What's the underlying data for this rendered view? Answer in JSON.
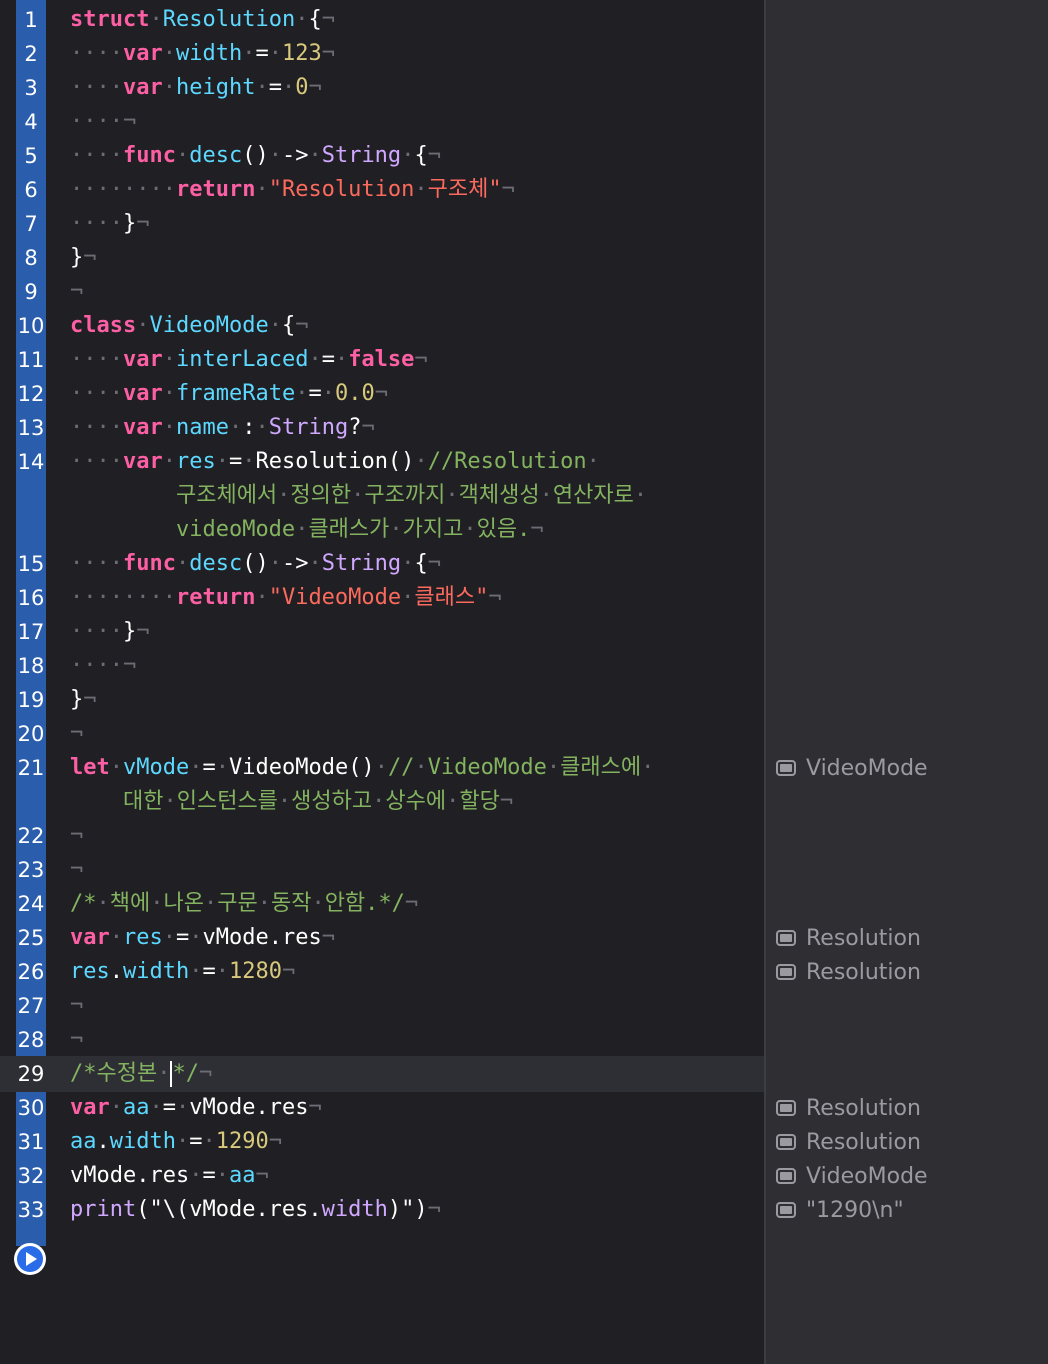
{
  "editor": {
    "highlighted_line": 29,
    "lines": [
      {
        "n": "1",
        "rows": [
          [
            [
              "kw",
              "struct"
            ],
            [
              "ws",
              "·"
            ],
            [
              "decl",
              "Resolution"
            ],
            [
              "ws",
              "·"
            ],
            [
              "pl",
              "{"
            ],
            [
              "ws",
              "¬"
            ]
          ]
        ]
      },
      {
        "n": "2",
        "rows": [
          [
            [
              "ws",
              "····"
            ],
            [
              "kw",
              "var"
            ],
            [
              "ws",
              "·"
            ],
            [
              "decl",
              "width"
            ],
            [
              "ws",
              "·"
            ],
            [
              "pl",
              "="
            ],
            [
              "ws",
              "·"
            ],
            [
              "num",
              "123"
            ],
            [
              "ws",
              "¬"
            ]
          ]
        ]
      },
      {
        "n": "3",
        "rows": [
          [
            [
              "ws",
              "····"
            ],
            [
              "kw",
              "var"
            ],
            [
              "ws",
              "·"
            ],
            [
              "decl",
              "height"
            ],
            [
              "ws",
              "·"
            ],
            [
              "pl",
              "="
            ],
            [
              "ws",
              "·"
            ],
            [
              "num",
              "0"
            ],
            [
              "ws",
              "¬"
            ]
          ]
        ]
      },
      {
        "n": "4",
        "rows": [
          [
            [
              "ws",
              "····¬"
            ]
          ]
        ]
      },
      {
        "n": "5",
        "rows": [
          [
            [
              "ws",
              "····"
            ],
            [
              "kw",
              "func"
            ],
            [
              "ws",
              "·"
            ],
            [
              "decl",
              "desc"
            ],
            [
              "pl",
              "()"
            ],
            [
              "ws",
              "·"
            ],
            [
              "pl",
              "->"
            ],
            [
              "ws",
              "·"
            ],
            [
              "ty",
              "String"
            ],
            [
              "ws",
              "·"
            ],
            [
              "pl",
              "{"
            ],
            [
              "ws",
              "¬"
            ]
          ]
        ]
      },
      {
        "n": "6",
        "rows": [
          [
            [
              "ws",
              "········"
            ],
            [
              "kw",
              "return"
            ],
            [
              "ws",
              "·"
            ],
            [
              "str",
              "\"Resolution"
            ],
            [
              "ws",
              "·"
            ],
            [
              "str",
              "구조체\""
            ],
            [
              "ws",
              "¬"
            ]
          ]
        ]
      },
      {
        "n": "7",
        "rows": [
          [
            [
              "ws",
              "····"
            ],
            [
              "pl",
              "}"
            ],
            [
              "ws",
              "¬"
            ]
          ]
        ]
      },
      {
        "n": "8",
        "rows": [
          [
            [
              "pl",
              "}"
            ],
            [
              "ws",
              "¬"
            ]
          ]
        ]
      },
      {
        "n": "9",
        "rows": [
          [
            [
              "ws",
              "¬"
            ]
          ]
        ]
      },
      {
        "n": "10",
        "rows": [
          [
            [
              "kw",
              "class"
            ],
            [
              "ws",
              "·"
            ],
            [
              "decl",
              "VideoMode"
            ],
            [
              "ws",
              "·"
            ],
            [
              "pl",
              "{"
            ],
            [
              "ws",
              "¬"
            ]
          ]
        ]
      },
      {
        "n": "11",
        "rows": [
          [
            [
              "ws",
              "····"
            ],
            [
              "kw",
              "var"
            ],
            [
              "ws",
              "·"
            ],
            [
              "decl",
              "interLaced"
            ],
            [
              "ws",
              "·"
            ],
            [
              "pl",
              "="
            ],
            [
              "ws",
              "·"
            ],
            [
              "kw",
              "false"
            ],
            [
              "ws",
              "¬"
            ]
          ]
        ]
      },
      {
        "n": "12",
        "rows": [
          [
            [
              "ws",
              "····"
            ],
            [
              "kw",
              "var"
            ],
            [
              "ws",
              "·"
            ],
            [
              "decl",
              "frameRate"
            ],
            [
              "ws",
              "·"
            ],
            [
              "pl",
              "="
            ],
            [
              "ws",
              "·"
            ],
            [
              "num",
              "0.0"
            ],
            [
              "ws",
              "¬"
            ]
          ]
        ]
      },
      {
        "n": "13",
        "rows": [
          [
            [
              "ws",
              "····"
            ],
            [
              "kw",
              "var"
            ],
            [
              "ws",
              "·"
            ],
            [
              "decl",
              "name"
            ],
            [
              "ws",
              "·"
            ],
            [
              "pl",
              ":"
            ],
            [
              "ws",
              "·"
            ],
            [
              "ty",
              "String"
            ],
            [
              "pl",
              "?"
            ],
            [
              "ws",
              "¬"
            ]
          ]
        ]
      },
      {
        "n": "14",
        "rows": [
          [
            [
              "ws",
              "····"
            ],
            [
              "kw",
              "var"
            ],
            [
              "ws",
              "·"
            ],
            [
              "decl",
              "res"
            ],
            [
              "ws",
              "·"
            ],
            [
              "pl",
              "="
            ],
            [
              "ws",
              "·"
            ],
            [
              "pl",
              "Resolution()"
            ],
            [
              "ws",
              "·"
            ],
            [
              "cm",
              "//Resolution"
            ],
            [
              "ws",
              "·"
            ]
          ],
          [
            [
              "ws",
              "        "
            ],
            [
              "cm",
              "구조체에서"
            ],
            [
              "ws",
              "·"
            ],
            [
              "cm",
              "정의한"
            ],
            [
              "ws",
              "·"
            ],
            [
              "cm",
              "구조까지"
            ],
            [
              "ws",
              "·"
            ],
            [
              "cm",
              "객체생성"
            ],
            [
              "ws",
              "·"
            ],
            [
              "cm",
              "연산자로"
            ],
            [
              "ws",
              "·"
            ]
          ],
          [
            [
              "ws",
              "        "
            ],
            [
              "cm",
              "videoMode"
            ],
            [
              "ws",
              "·"
            ],
            [
              "cm",
              "클래스가"
            ],
            [
              "ws",
              "·"
            ],
            [
              "cm",
              "가지고"
            ],
            [
              "ws",
              "·"
            ],
            [
              "cm",
              "있음."
            ],
            [
              "ws",
              "¬"
            ]
          ]
        ]
      },
      {
        "n": "15",
        "rows": [
          [
            [
              "ws",
              "····"
            ],
            [
              "kw",
              "func"
            ],
            [
              "ws",
              "·"
            ],
            [
              "decl",
              "desc"
            ],
            [
              "pl",
              "()"
            ],
            [
              "ws",
              "·"
            ],
            [
              "pl",
              "->"
            ],
            [
              "ws",
              "·"
            ],
            [
              "ty",
              "String"
            ],
            [
              "ws",
              "·"
            ],
            [
              "pl",
              "{"
            ],
            [
              "ws",
              "¬"
            ]
          ]
        ]
      },
      {
        "n": "16",
        "rows": [
          [
            [
              "ws",
              "········"
            ],
            [
              "kw",
              "return"
            ],
            [
              "ws",
              "·"
            ],
            [
              "str",
              "\"VideoMode"
            ],
            [
              "ws",
              "·"
            ],
            [
              "str",
              "클래스\""
            ],
            [
              "ws",
              "¬"
            ]
          ]
        ]
      },
      {
        "n": "17",
        "rows": [
          [
            [
              "ws",
              "····"
            ],
            [
              "pl",
              "}"
            ],
            [
              "ws",
              "¬"
            ]
          ]
        ]
      },
      {
        "n": "18",
        "rows": [
          [
            [
              "ws",
              "····¬"
            ]
          ]
        ]
      },
      {
        "n": "19",
        "rows": [
          [
            [
              "pl",
              "}"
            ],
            [
              "ws",
              "¬"
            ]
          ]
        ]
      },
      {
        "n": "20",
        "rows": [
          [
            [
              "ws",
              "¬"
            ]
          ]
        ]
      },
      {
        "n": "21",
        "rows": [
          [
            [
              "kw",
              "let"
            ],
            [
              "ws",
              "·"
            ],
            [
              "decl",
              "vMode"
            ],
            [
              "ws",
              "·"
            ],
            [
              "pl",
              "="
            ],
            [
              "ws",
              "·"
            ],
            [
              "pl",
              "VideoMode()"
            ],
            [
              "ws",
              "·"
            ],
            [
              "cm",
              "//"
            ],
            [
              "ws",
              "·"
            ],
            [
              "cm",
              "VideoMode"
            ],
            [
              "ws",
              "·"
            ],
            [
              "cm",
              "클래스에"
            ],
            [
              "ws",
              "·"
            ]
          ],
          [
            [
              "ws",
              "    "
            ],
            [
              "cm",
              "대한"
            ],
            [
              "ws",
              "·"
            ],
            [
              "cm",
              "인스턴스를"
            ],
            [
              "ws",
              "·"
            ],
            [
              "cm",
              "생성하고"
            ],
            [
              "ws",
              "·"
            ],
            [
              "cm",
              "상수에"
            ],
            [
              "ws",
              "·"
            ],
            [
              "cm",
              "할당"
            ],
            [
              "ws",
              "¬"
            ]
          ]
        ]
      },
      {
        "n": "22",
        "rows": [
          [
            [
              "ws",
              "¬"
            ]
          ]
        ]
      },
      {
        "n": "23",
        "rows": [
          [
            [
              "ws",
              "¬"
            ]
          ]
        ]
      },
      {
        "n": "24",
        "rows": [
          [
            [
              "cm",
              "/*"
            ],
            [
              "ws",
              "·"
            ],
            [
              "cm",
              "책에"
            ],
            [
              "ws",
              "·"
            ],
            [
              "cm",
              "나온"
            ],
            [
              "ws",
              "·"
            ],
            [
              "cm",
              "구문"
            ],
            [
              "ws",
              "·"
            ],
            [
              "cm",
              "동작"
            ],
            [
              "ws",
              "·"
            ],
            [
              "cm",
              "안함.*/"
            ],
            [
              "ws",
              "¬"
            ]
          ]
        ]
      },
      {
        "n": "25",
        "rows": [
          [
            [
              "kw",
              "var"
            ],
            [
              "ws",
              "·"
            ],
            [
              "decl",
              "res"
            ],
            [
              "ws",
              "·"
            ],
            [
              "pl",
              "="
            ],
            [
              "ws",
              "·"
            ],
            [
              "pl",
              "vMode.res"
            ],
            [
              "ws",
              "¬"
            ]
          ]
        ]
      },
      {
        "n": "26",
        "rows": [
          [
            [
              "decl",
              "res"
            ],
            [
              "pl",
              "."
            ],
            [
              "decl",
              "width"
            ],
            [
              "ws",
              "·"
            ],
            [
              "pl",
              "="
            ],
            [
              "ws",
              "·"
            ],
            [
              "num",
              "1280"
            ],
            [
              "ws",
              "¬"
            ]
          ]
        ]
      },
      {
        "n": "27",
        "rows": [
          [
            [
              "ws",
              "¬"
            ]
          ]
        ]
      },
      {
        "n": "28",
        "rows": [
          [
            [
              "ws",
              "¬"
            ]
          ]
        ]
      },
      {
        "n": "29",
        "rows": [
          [
            [
              "cm",
              "/*수정본"
            ],
            [
              "ws",
              "·"
            ],
            [
              "cursor",
              ""
            ],
            [
              "cm",
              "*/"
            ],
            [
              "ws",
              "¬"
            ]
          ]
        ]
      },
      {
        "n": "30",
        "rows": [
          [
            [
              "kw",
              "var"
            ],
            [
              "ws",
              "·"
            ],
            [
              "decl",
              "aa"
            ],
            [
              "ws",
              "·"
            ],
            [
              "pl",
              "="
            ],
            [
              "ws",
              "·"
            ],
            [
              "pl",
              "vMode.res"
            ],
            [
              "ws",
              "¬"
            ]
          ]
        ]
      },
      {
        "n": "31",
        "rows": [
          [
            [
              "decl",
              "aa"
            ],
            [
              "pl",
              "."
            ],
            [
              "decl",
              "width"
            ],
            [
              "ws",
              "·"
            ],
            [
              "pl",
              "="
            ],
            [
              "ws",
              "·"
            ],
            [
              "num",
              "1290"
            ],
            [
              "ws",
              "¬"
            ]
          ]
        ]
      },
      {
        "n": "32",
        "rows": [
          [
            [
              "pl",
              "vMode.res"
            ],
            [
              "ws",
              "·"
            ],
            [
              "pl",
              "="
            ],
            [
              "ws",
              "·"
            ],
            [
              "decl",
              "aa"
            ],
            [
              "ws",
              "¬"
            ]
          ]
        ]
      },
      {
        "n": "33",
        "rows": [
          [
            [
              "ty",
              "print"
            ],
            [
              "pl",
              "(\"\\(vMode.res."
            ],
            [
              "ty",
              "width"
            ],
            [
              "pl",
              ")\")"
            ],
            [
              "ws",
              "¬"
            ]
          ]
        ]
      }
    ]
  },
  "results": [
    {
      "line": "21",
      "text": "VideoMode",
      "icon": "quick-look-icon"
    },
    {
      "line": "25",
      "text": "Resolution",
      "icon": "quick-look-icon"
    },
    {
      "line": "26",
      "text": "Resolution",
      "icon": "quick-look-icon"
    },
    {
      "line": "30",
      "text": "Resolution",
      "icon": "quick-look-icon"
    },
    {
      "line": "31",
      "text": "Resolution",
      "icon": "quick-look-icon"
    },
    {
      "line": "32",
      "text": "VideoMode",
      "icon": "quick-look-icon"
    },
    {
      "line": "33",
      "text": "\"1290\\n\"",
      "icon": "quick-look-icon"
    }
  ],
  "run_button": {
    "icon": "play-icon"
  }
}
